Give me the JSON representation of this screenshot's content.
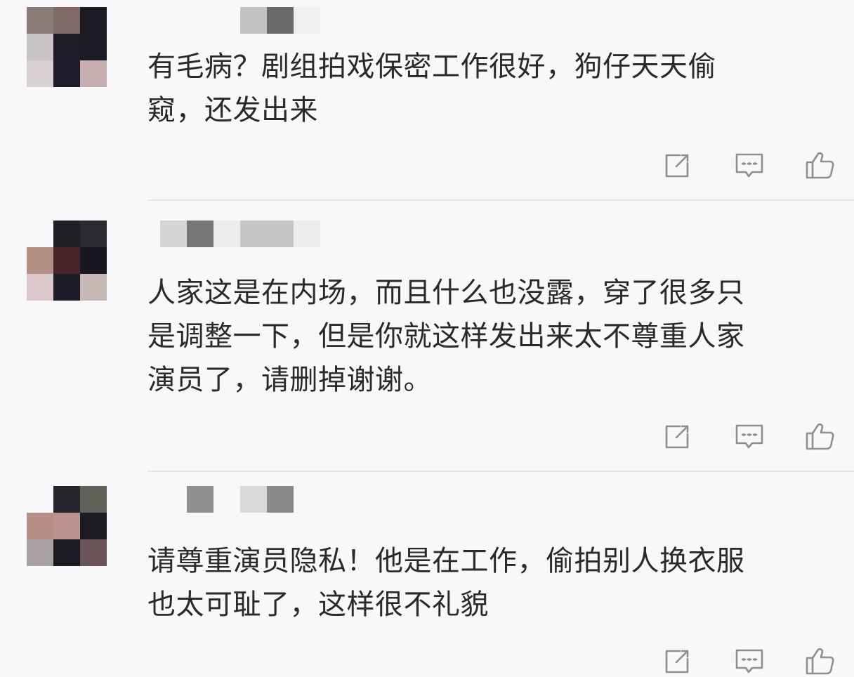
{
  "comments": [
    {
      "text": "有毛病？剧组拍戏保密工作很好，狗仔天天偷\n窥，还发出来",
      "avatar_colors": [
        "#8a7c78",
        "#7f6a66",
        "#1d1a24",
        "#c9c4c8",
        "#1f1c2a",
        "#1c1a26",
        "#d8d0d2",
        "#1d1b2c",
        "#c7aeb0"
      ],
      "username_colors": [
        "#f8f8fa",
        "#c2c2c4",
        "#6a6a6d",
        "#f0f0f2",
        "#f8f8fa",
        "#f8f8fa"
      ]
    },
    {
      "text": "人家这是在内场，而且什么也没露，穿了很多只\n是调整一下，但是你就这样发出来太不尊重人家\n演员了，请删掉谢谢。",
      "avatar_colors": [
        "#f8f8fa",
        "#222026",
        "#2c2a2e",
        "#b59085",
        "#4a2428",
        "#18161f",
        "#dcc8ca",
        "#1b1a27",
        "#c6b8b4"
      ],
      "username_colors": [
        "#d6d6d8",
        "#767678",
        "#ececee",
        "#c7c7c9",
        "#c7c7c9",
        "#ececee"
      ]
    },
    {
      "text": "请尊重演员隐私！他是在工作，偷拍别人换衣服\n也太可耻了，这样很不礼貌",
      "avatar_colors": [
        "#f8f8fa",
        "#27252b",
        "#5f6058",
        "#b68e88",
        "#ba9390",
        "#1d1b24",
        "#a8a0a2",
        "#1b1922",
        "#6a5458"
      ],
      "username_colors": [
        "#f8f8fa",
        "#8f8f91",
        "#f8f8fa",
        "#d9d9db",
        "#8a8a8c",
        "#f8f8fa"
      ]
    }
  ],
  "actions": [
    {
      "icon": "share-icon"
    },
    {
      "icon": "comment-icon"
    },
    {
      "icon": "like-icon"
    }
  ],
  "colors": {
    "icon_stroke": "#8e8e93",
    "text": "#2a2a2a",
    "divider": "#e6e6ea"
  }
}
